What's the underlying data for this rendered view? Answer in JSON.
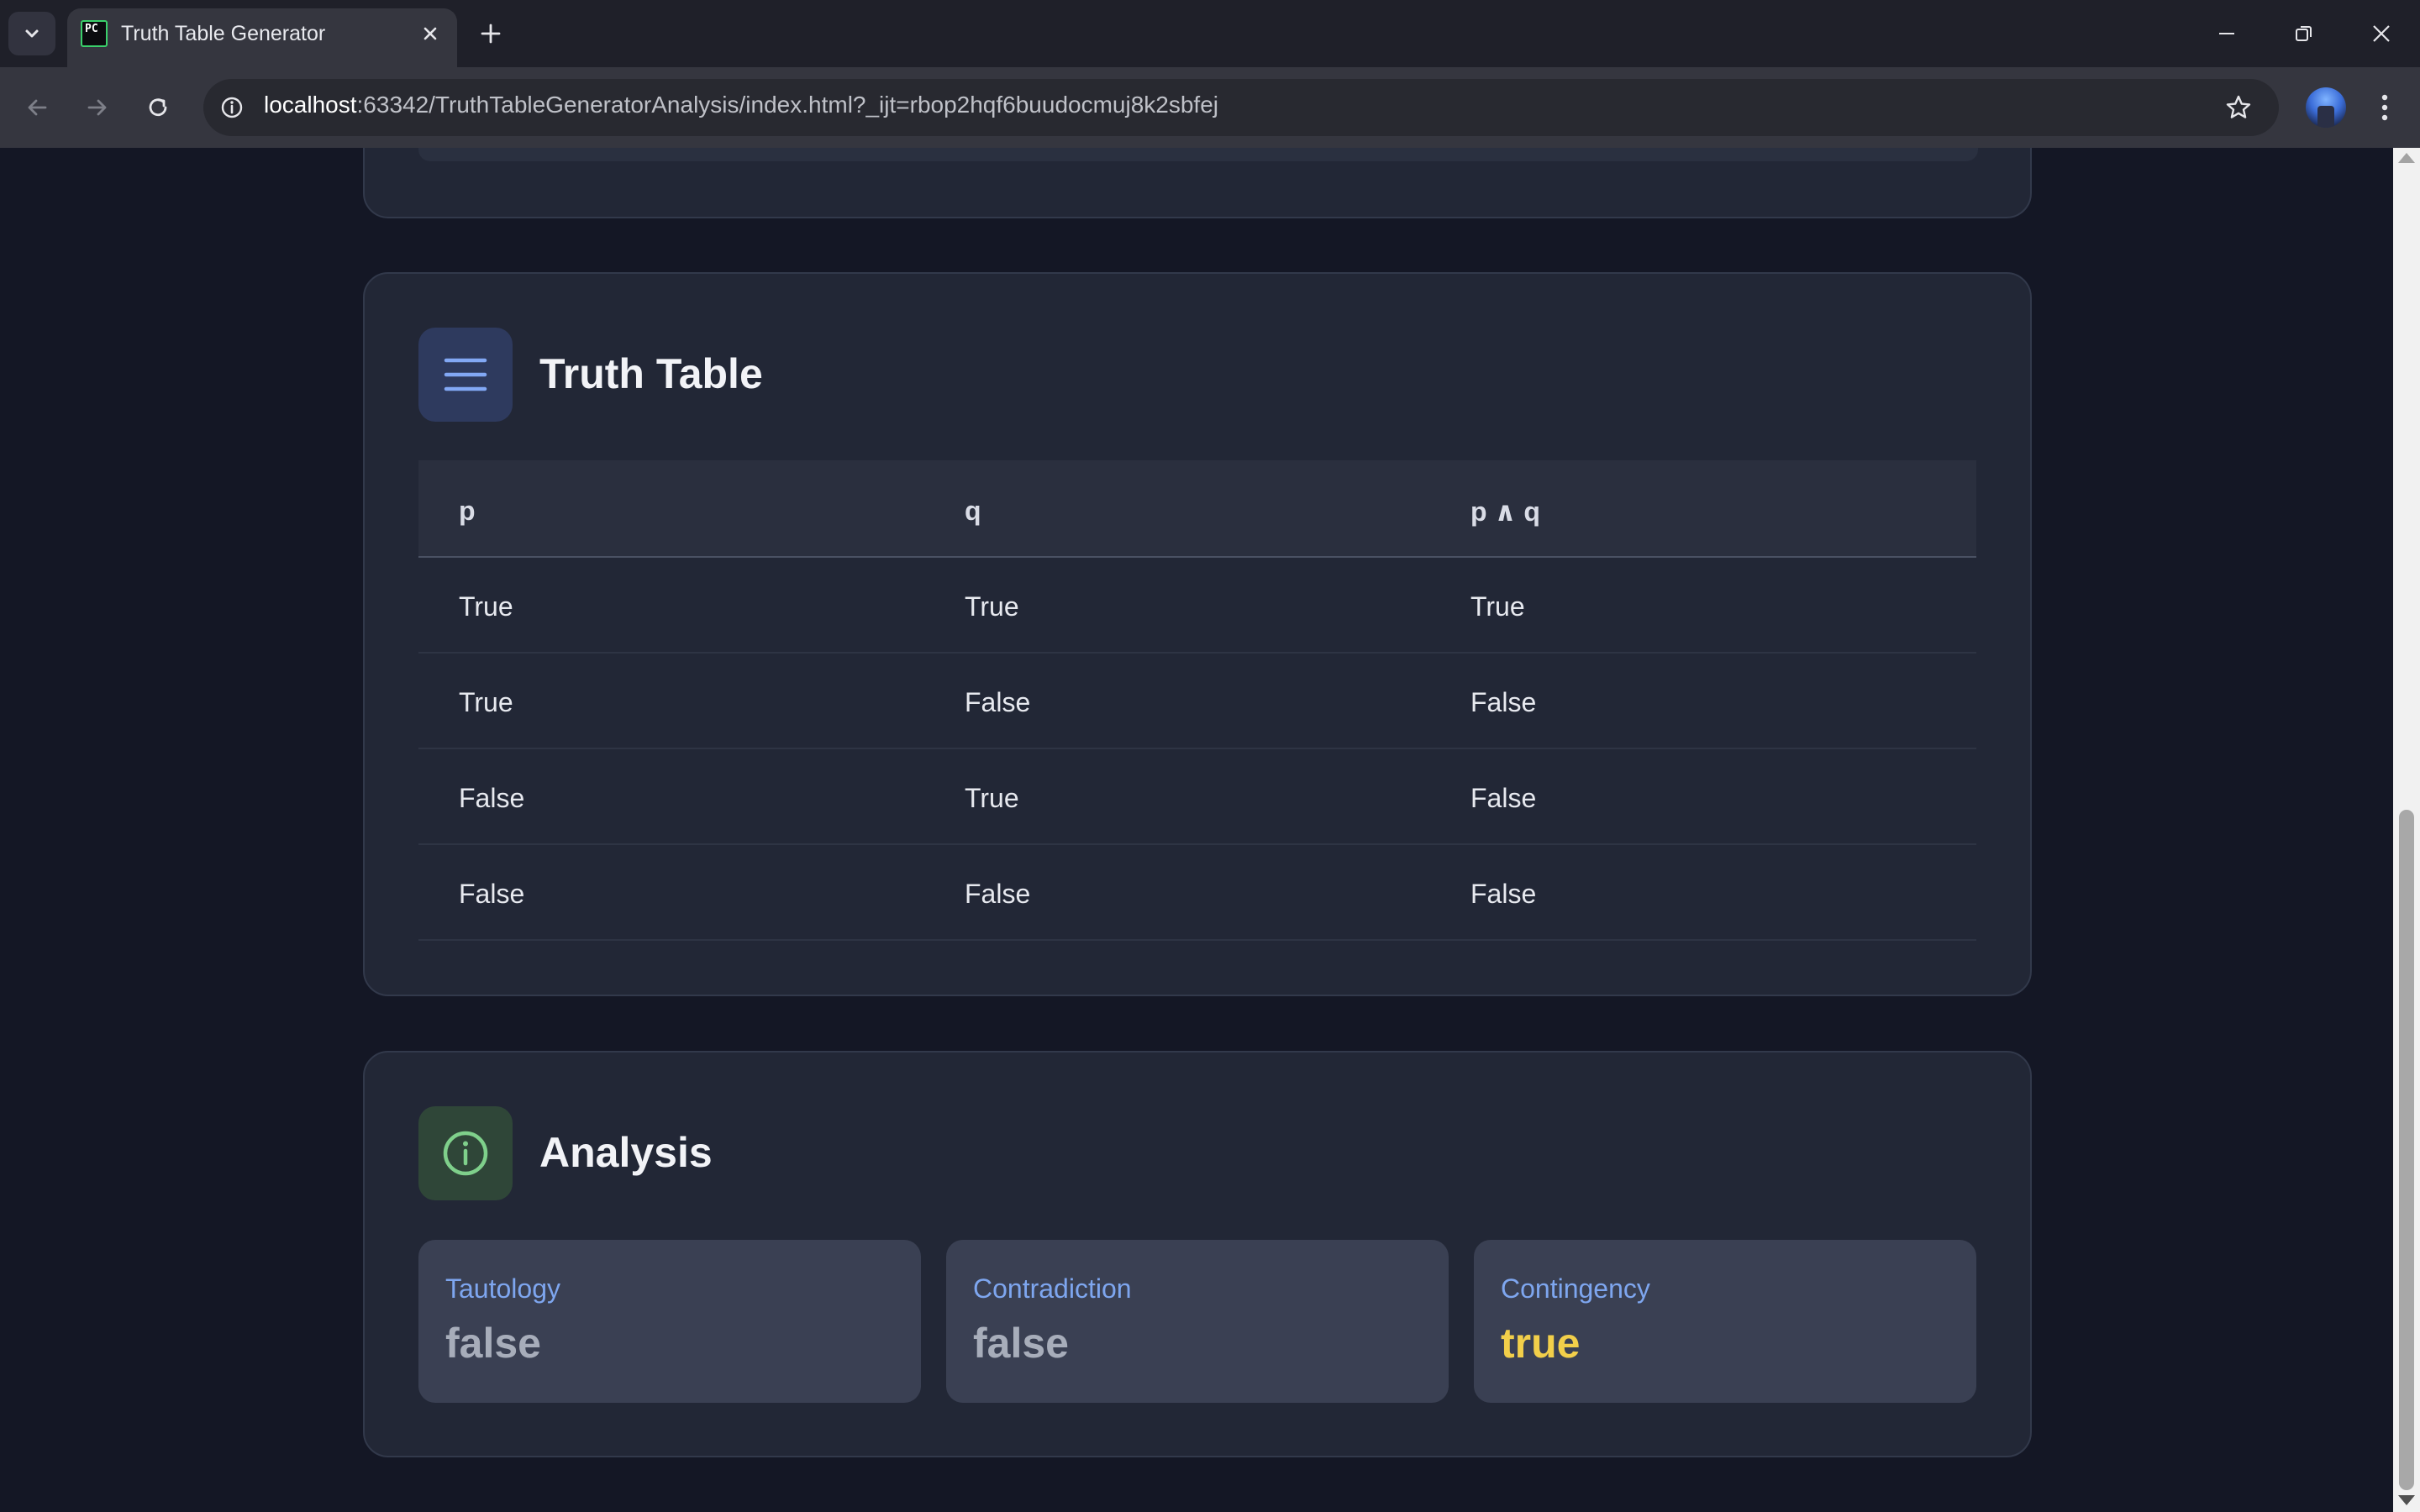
{
  "browser": {
    "tab_title": "Truth Table Generator",
    "favicon_text": "PC",
    "url_host": "localhost",
    "url_rest": ":63342/TruthTableGeneratorAnalysis/index.html?_ijt=rbop2hqf6buudocmuj8k2sbfej"
  },
  "truth_table": {
    "title": "Truth Table",
    "icon": "list-icon",
    "headers": [
      "p",
      "q",
      "p ∧ q"
    ],
    "rows": [
      [
        "True",
        "True",
        "True"
      ],
      [
        "True",
        "False",
        "False"
      ],
      [
        "False",
        "True",
        "False"
      ],
      [
        "False",
        "False",
        "False"
      ]
    ]
  },
  "analysis": {
    "title": "Analysis",
    "icon": "info-icon",
    "metrics": [
      {
        "label": "Tautology",
        "value": "false"
      },
      {
        "label": "Contradiction",
        "value": "false"
      },
      {
        "label": "Contingency",
        "value": "true"
      }
    ]
  },
  "colors": {
    "background": "#141725",
    "card": "#222736",
    "accent_blue": "#7ea6ef",
    "true_value": "#f2cf4a",
    "false_value": "#a7adba",
    "icon_green": "#7fd08b"
  }
}
